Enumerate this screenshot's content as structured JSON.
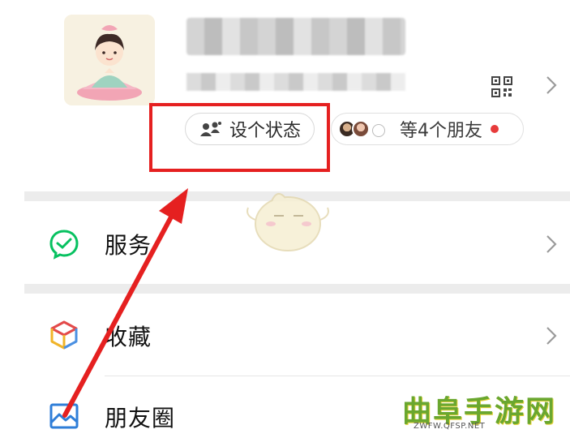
{
  "profile": {
    "status_button_label": "设个状态",
    "friends_label": "等4个朋友",
    "status_icon": "people-status-icon",
    "qr_icon": "qr-code-icon"
  },
  "menu": {
    "items": [
      {
        "label": "服务",
        "icon": "service-check-icon",
        "color": "#07c160"
      },
      {
        "label": "收藏",
        "icon": "favorites-cube-icon",
        "color": "#4a90e2"
      },
      {
        "label": "朋友圈",
        "icon": "moments-image-icon",
        "color": "#2f7ed8"
      }
    ]
  },
  "watermark": {
    "title": "曲阜手游网",
    "url": "ZWFW.QFSP.NET"
  },
  "colors": {
    "highlight": "#e52020",
    "notification_dot": "#e73b3b",
    "watermark_green": "#6aa72f"
  }
}
